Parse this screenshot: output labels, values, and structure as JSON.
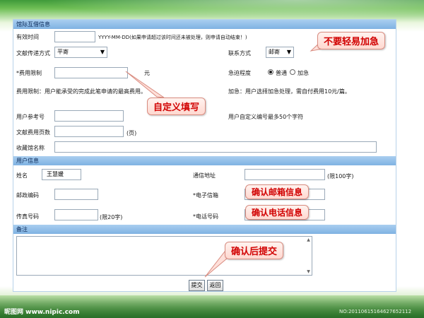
{
  "section_journal": {
    "title": "馆际互借信息"
  },
  "section_user": {
    "title": "用户信息"
  },
  "section_remark": {
    "title": "备注"
  },
  "fields": {
    "valid_time": {
      "label": "有效时间",
      "hint": "YYYY-MM-DD(如果申请超过该时间还未被处理，则申请自动结束！)"
    },
    "delivery_method": {
      "label": "文献传递方式",
      "selected": "平寄"
    },
    "contact_method": {
      "label": "联系方式",
      "selected": "邮寄"
    },
    "fee_limit": {
      "label": "*费用限制",
      "unit": "元"
    },
    "urgency": {
      "label": "急迫程度",
      "option_normal": "普通",
      "option_urgent": "加急",
      "selected": "普通"
    },
    "fee_limit_note": "费用限制：用户能承受的完成此笔申请的最高费用。",
    "urgent_note": "加急：用户选择加急处理，需自付费用10元/篇。",
    "user_ref": {
      "label": "用户参考号"
    },
    "user_ref_note": "用户自定义编号最多50个字符",
    "page_count": {
      "label": "文献费用页数",
      "unit": "(页)"
    },
    "library_name": {
      "label": "收藏馆名称"
    },
    "name": {
      "label": "姓名",
      "value": "王慧媛"
    },
    "address": {
      "label": "通信地址",
      "limit": "(限100字)"
    },
    "postcode": {
      "label": "邮政编码"
    },
    "email": {
      "label": "*电子信箱"
    },
    "fax": {
      "label": "传真号码",
      "limit": "(限20字)"
    },
    "phone": {
      "label": "*电话号码"
    }
  },
  "buttons": {
    "submit": "提交",
    "back": "返回"
  },
  "callouts": {
    "no_urgent": "不要轻易加急",
    "custom_fill": "自定义填写",
    "confirm_email": "确认邮箱信息",
    "confirm_phone": "确认电话信息",
    "confirm_submit": "确认后提交"
  },
  "watermark": {
    "left": "昵图网 www.nipic.com",
    "right": "NO:20110615164627652112"
  },
  "colors": {
    "section_bar": "#8dbde8",
    "callout_text": "#d10000",
    "callout_bg": "#ffe0da",
    "bg_green": "#4ea43f"
  }
}
